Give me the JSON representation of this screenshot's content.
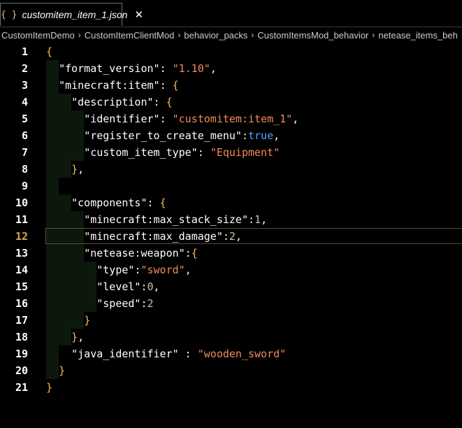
{
  "tab": {
    "icon": "{ }",
    "title": "customitem_item_1.json",
    "close": "✕"
  },
  "breadcrumb": [
    "CustomItemDemo",
    "CustomItemClientMod",
    "behavior_packs",
    "CustomItemsMod_behavior",
    "netease_items_beh"
  ],
  "breadcrumb_sep": "›",
  "editor": {
    "current_line": 12,
    "lines": [
      {
        "n": "1",
        "tokens": [
          {
            "t": "{",
            "c": "brace"
          }
        ]
      },
      {
        "n": "2",
        "tokens": [
          {
            "t": "  "
          },
          {
            "t": "\"format_version\"",
            "c": "key"
          },
          {
            "t": ": "
          },
          {
            "t": "\"1.10\"",
            "c": "str"
          },
          {
            "t": ","
          }
        ]
      },
      {
        "n": "3",
        "tokens": [
          {
            "t": "  "
          },
          {
            "t": "\"minecraft:item\"",
            "c": "key"
          },
          {
            "t": ": "
          },
          {
            "t": "{",
            "c": "brace"
          }
        ]
      },
      {
        "n": "4",
        "tokens": [
          {
            "t": "    "
          },
          {
            "t": "\"description\"",
            "c": "key"
          },
          {
            "t": ": "
          },
          {
            "t": "{",
            "c": "brace"
          }
        ]
      },
      {
        "n": "5",
        "tokens": [
          {
            "t": "      "
          },
          {
            "t": "\"identifier\"",
            "c": "key"
          },
          {
            "t": ": "
          },
          {
            "t": "\"customitem:item_1\"",
            "c": "str"
          },
          {
            "t": ","
          }
        ]
      },
      {
        "n": "6",
        "tokens": [
          {
            "t": "      "
          },
          {
            "t": "\"register_to_create_menu\"",
            "c": "key"
          },
          {
            "t": ":"
          },
          {
            "t": "true",
            "c": "bool"
          },
          {
            "t": ","
          }
        ]
      },
      {
        "n": "7",
        "tokens": [
          {
            "t": "      "
          },
          {
            "t": "\"custom_item_type\"",
            "c": "key"
          },
          {
            "t": ": "
          },
          {
            "t": "\"Equipment\"",
            "c": "str"
          }
        ]
      },
      {
        "n": "8",
        "tokens": [
          {
            "t": "    "
          },
          {
            "t": "}",
            "c": "brace"
          },
          {
            "t": ","
          }
        ]
      },
      {
        "n": "9",
        "tokens": []
      },
      {
        "n": "10",
        "tokens": [
          {
            "t": "    "
          },
          {
            "t": "\"components\"",
            "c": "key"
          },
          {
            "t": ": "
          },
          {
            "t": "{",
            "c": "brace"
          }
        ]
      },
      {
        "n": "11",
        "tokens": [
          {
            "t": "      "
          },
          {
            "t": "\"minecraft:max_stack_size\"",
            "c": "key"
          },
          {
            "t": ":"
          },
          {
            "t": "1",
            "c": "num"
          },
          {
            "t": ","
          }
        ]
      },
      {
        "n": "12",
        "tokens": [
          {
            "t": "      "
          },
          {
            "t": "\"minecraft:max_damage\"",
            "c": "key"
          },
          {
            "t": ":"
          },
          {
            "t": "2",
            "c": "num"
          },
          {
            "t": ","
          }
        ]
      },
      {
        "n": "13",
        "tokens": [
          {
            "t": "      "
          },
          {
            "t": "\"netease:weapon\"",
            "c": "key"
          },
          {
            "t": ":"
          },
          {
            "t": "{",
            "c": "brace"
          }
        ]
      },
      {
        "n": "14",
        "tokens": [
          {
            "t": "        "
          },
          {
            "t": "\"type\"",
            "c": "key"
          },
          {
            "t": ":"
          },
          {
            "t": "\"sword\"",
            "c": "str"
          },
          {
            "t": ","
          }
        ]
      },
      {
        "n": "15",
        "tokens": [
          {
            "t": "        "
          },
          {
            "t": "\"level\"",
            "c": "key"
          },
          {
            "t": ":"
          },
          {
            "t": "0",
            "c": "num"
          },
          {
            "t": ","
          }
        ]
      },
      {
        "n": "16",
        "tokens": [
          {
            "t": "        "
          },
          {
            "t": "\"speed\"",
            "c": "key"
          },
          {
            "t": ":"
          },
          {
            "t": "2",
            "c": "num"
          }
        ]
      },
      {
        "n": "17",
        "tokens": [
          {
            "t": "      "
          },
          {
            "t": "}",
            "c": "brace"
          }
        ]
      },
      {
        "n": "18",
        "tokens": [
          {
            "t": "    "
          },
          {
            "t": "}",
            "c": "brace"
          },
          {
            "t": ","
          }
        ]
      },
      {
        "n": "19",
        "tokens": [
          {
            "t": "    "
          },
          {
            "t": "\"java_identifier\"",
            "c": "key"
          },
          {
            "t": " : "
          },
          {
            "t": "\"wooden_sword\"",
            "c": "str"
          }
        ]
      },
      {
        "n": "20",
        "tokens": [
          {
            "t": "  "
          },
          {
            "t": "}",
            "c": "brace"
          }
        ]
      },
      {
        "n": "21",
        "tokens": [
          {
            "t": "}",
            "c": "brace"
          }
        ]
      }
    ]
  }
}
